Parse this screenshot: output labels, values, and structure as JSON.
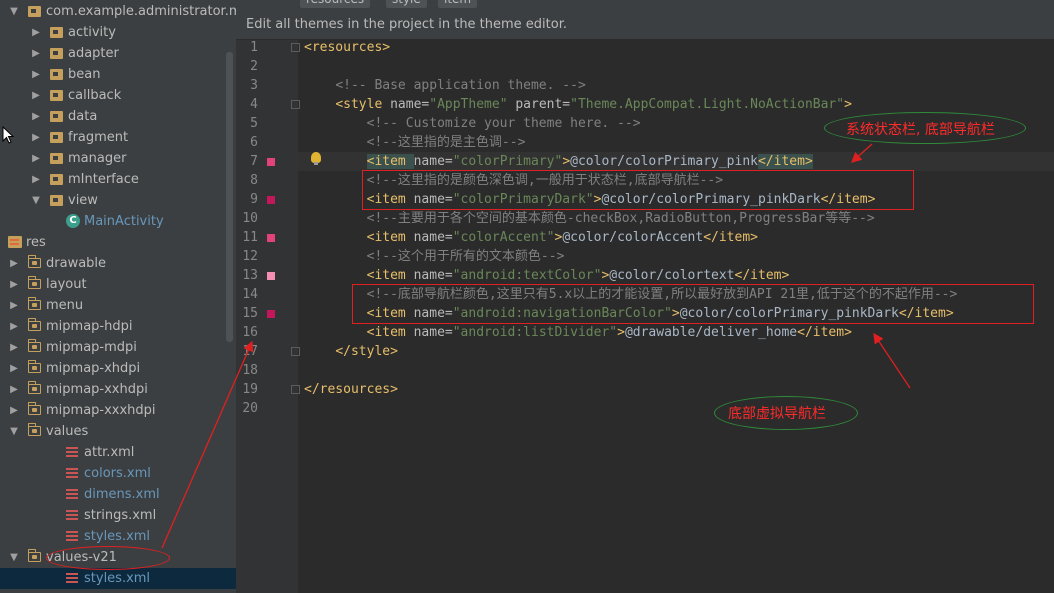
{
  "tabs": [
    "resources",
    "style",
    "item"
  ],
  "banner": "Edit all themes in the project in the theme editor.",
  "tree": [
    {
      "label": "com.example.administrator.m",
      "indent": 30,
      "arrow": "▼",
      "icon": "package-icon"
    },
    {
      "label": "activity",
      "indent": 52,
      "arrow": "▶",
      "icon": "package-icon"
    },
    {
      "label": "adapter",
      "indent": 52,
      "arrow": "▶",
      "icon": "package-icon"
    },
    {
      "label": "bean",
      "indent": 52,
      "arrow": "▶",
      "icon": "package-icon"
    },
    {
      "label": "callback",
      "indent": 52,
      "arrow": "▶",
      "icon": "package-icon"
    },
    {
      "label": "data",
      "indent": 52,
      "arrow": "▶",
      "icon": "package-icon"
    },
    {
      "label": "fragment",
      "indent": 52,
      "arrow": "▶",
      "icon": "package-icon"
    },
    {
      "label": "manager",
      "indent": 52,
      "arrow": "▶",
      "icon": "package-icon"
    },
    {
      "label": "mInterface",
      "indent": 52,
      "arrow": "▶",
      "icon": "package-icon"
    },
    {
      "label": "view",
      "indent": 52,
      "arrow": "▼",
      "icon": "package-icon"
    },
    {
      "label": "MainActivity",
      "indent": 68,
      "arrow": "",
      "icon": "class-icon",
      "blue": true
    },
    {
      "label": "res",
      "indent": 10,
      "arrow": "▼",
      "icon": "res-folder-icon"
    },
    {
      "label": "drawable",
      "indent": 30,
      "arrow": "▶",
      "icon": "folder-icon"
    },
    {
      "label": "layout",
      "indent": 30,
      "arrow": "▶",
      "icon": "folder-icon"
    },
    {
      "label": "menu",
      "indent": 30,
      "arrow": "▶",
      "icon": "folder-icon"
    },
    {
      "label": "mipmap-hdpi",
      "indent": 30,
      "arrow": "▶",
      "icon": "folder-icon"
    },
    {
      "label": "mipmap-mdpi",
      "indent": 30,
      "arrow": "▶",
      "icon": "folder-icon"
    },
    {
      "label": "mipmap-xhdpi",
      "indent": 30,
      "arrow": "▶",
      "icon": "folder-icon"
    },
    {
      "label": "mipmap-xxhdpi",
      "indent": 30,
      "arrow": "▶",
      "icon": "folder-icon"
    },
    {
      "label": "mipmap-xxxhdpi",
      "indent": 30,
      "arrow": "▶",
      "icon": "folder-icon"
    },
    {
      "label": "values",
      "indent": 30,
      "arrow": "▼",
      "icon": "folder-icon"
    },
    {
      "label": "attr.xml",
      "indent": 68,
      "arrow": "",
      "icon": "xml-icon"
    },
    {
      "label": "colors.xml",
      "indent": 68,
      "arrow": "",
      "icon": "xml-icon",
      "blue": true
    },
    {
      "label": "dimens.xml",
      "indent": 68,
      "arrow": "",
      "icon": "xml-icon",
      "blue": true
    },
    {
      "label": "strings.xml",
      "indent": 68,
      "arrow": "",
      "icon": "xml-icon"
    },
    {
      "label": "styles.xml",
      "indent": 68,
      "arrow": "",
      "icon": "xml-icon",
      "blue": true
    },
    {
      "label": "values-v21",
      "indent": 30,
      "arrow": "▼",
      "icon": "folder-icon"
    },
    {
      "label": "styles.xml",
      "indent": 68,
      "arrow": "",
      "icon": "xml-icon",
      "blue": true,
      "selected": true
    }
  ],
  "lines": [
    [
      [
        "t",
        "<resources>"
      ]
    ],
    [],
    [
      [
        "x",
        "    "
      ],
      [
        "c",
        "<!-- Base application theme. -->"
      ]
    ],
    [
      [
        "x",
        "    "
      ],
      [
        "t",
        "<style "
      ],
      [
        "a",
        "name="
      ],
      [
        "v",
        "\"AppTheme\" "
      ],
      [
        "a",
        "parent="
      ],
      [
        "v",
        "\"Theme.AppCompat.Light.NoActionBar\""
      ],
      [
        "t",
        ">"
      ]
    ],
    [
      [
        "x",
        "        "
      ],
      [
        "c",
        "<!-- Customize your theme here. -->"
      ]
    ],
    [
      [
        "x",
        "        "
      ],
      [
        "c",
        "<!--这里指的是主色调-->"
      ]
    ],
    [
      [
        "x",
        "        "
      ],
      [
        "tb",
        "<item "
      ],
      [
        "a",
        "name="
      ],
      [
        "v",
        "\"colorPrimary\""
      ],
      [
        "t",
        ">"
      ],
      [
        "x",
        "@color/colorPrimary_pink"
      ],
      [
        "tb",
        "</item>"
      ]
    ],
    [
      [
        "x",
        "        "
      ],
      [
        "c",
        "<!--这里指的是颜色深色调,一般用于状态栏,底部导航栏-->"
      ]
    ],
    [
      [
        "x",
        "        "
      ],
      [
        "t",
        "<item "
      ],
      [
        "a",
        "name="
      ],
      [
        "v",
        "\"colorPrimaryDark\""
      ],
      [
        "t",
        ">"
      ],
      [
        "x",
        "@color/colorPrimary_pinkDark"
      ],
      [
        "t",
        "</item>"
      ]
    ],
    [
      [
        "x",
        "        "
      ],
      [
        "c",
        "<!--主要用于各个空间的基本颜色-checkBox,RadioButton,ProgressBar等等-->"
      ]
    ],
    [
      [
        "x",
        "        "
      ],
      [
        "t",
        "<item "
      ],
      [
        "a",
        "name="
      ],
      [
        "v",
        "\"colorAccent\""
      ],
      [
        "t",
        ">"
      ],
      [
        "x",
        "@color/colorAccent"
      ],
      [
        "t",
        "</item>"
      ]
    ],
    [
      [
        "x",
        "        "
      ],
      [
        "c",
        "<!--这个用于所有的文本颜色-->"
      ]
    ],
    [
      [
        "x",
        "        "
      ],
      [
        "t",
        "<item "
      ],
      [
        "a",
        "name="
      ],
      [
        "v",
        "\"android:textColor\""
      ],
      [
        "t",
        ">"
      ],
      [
        "x",
        "@color/colortext"
      ],
      [
        "t",
        "</item>"
      ]
    ],
    [
      [
        "x",
        "        "
      ],
      [
        "c",
        "<!--底部导航栏颜色,这里只有5.x以上的才能设置,所以最好放到API 21里,低于这个的不起作用-->"
      ]
    ],
    [
      [
        "x",
        "        "
      ],
      [
        "t",
        "<item "
      ],
      [
        "a",
        "name="
      ],
      [
        "v",
        "\"android:navigationBarColor\""
      ],
      [
        "t",
        ">"
      ],
      [
        "x",
        "@color/colorPrimary_pinkDark"
      ],
      [
        "t",
        "</item>"
      ]
    ],
    [
      [
        "x",
        "        "
      ],
      [
        "t",
        "<item "
      ],
      [
        "a",
        "name="
      ],
      [
        "v",
        "\"android:listDivider\""
      ],
      [
        "t",
        ">"
      ],
      [
        "x",
        "@drawable/deliver_home"
      ],
      [
        "t",
        "</item>"
      ]
    ],
    [
      [
        "x",
        "    "
      ],
      [
        "t",
        "</style>"
      ]
    ],
    [],
    [
      [
        "t",
        "</resources>"
      ]
    ],
    []
  ],
  "swatches": [
    {
      "line": 7,
      "color": "#e2417a"
    },
    {
      "line": 9,
      "color": "#c2185b"
    },
    {
      "line": 11,
      "color": "#e2417a"
    },
    {
      "line": 13,
      "color": "#f48fb1"
    },
    {
      "line": 15,
      "color": "#c2185b"
    }
  ],
  "annotations": {
    "status_bar_note": "系统状态栏, 底部导航栏",
    "nav_bar_note": "底部虚拟导航栏"
  },
  "colors": {
    "annotation": "#ff2a2a",
    "oval": "#2f8a3a",
    "tree_bg": "#3c3f41",
    "editor_bg": "#2b2b2b"
  }
}
